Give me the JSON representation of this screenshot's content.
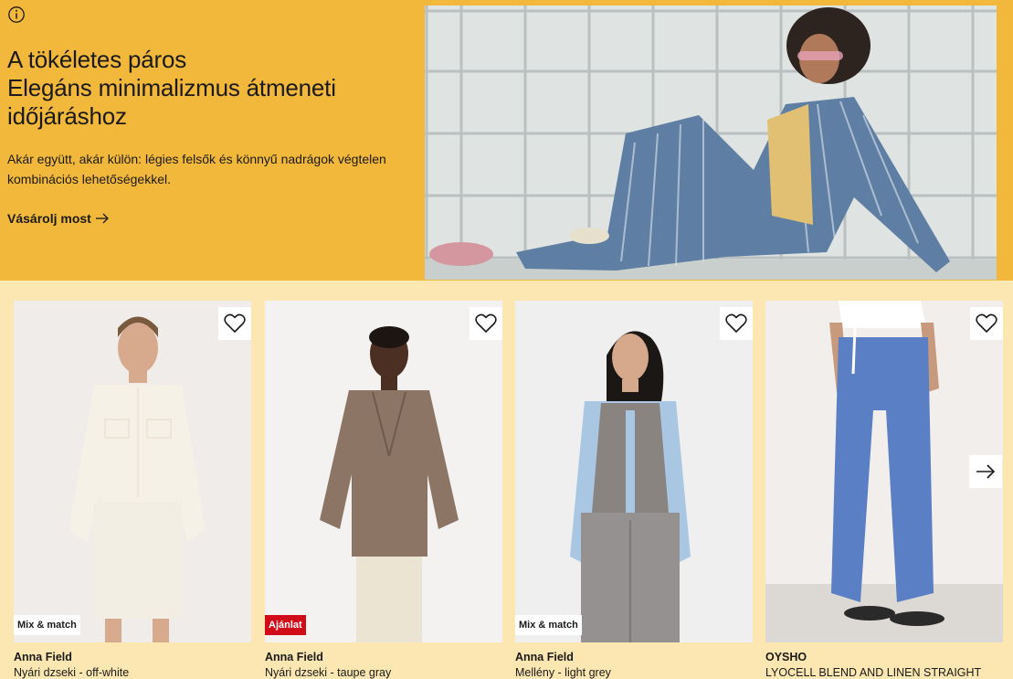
{
  "hero": {
    "title_lines": [
      "A tökéletes páros",
      "Elegáns minimalizmus átmeneti",
      "időjáráshoz"
    ],
    "description": "Akár együtt, akár külön: légies felsők és könnyű nadrágok végtelen kombinációs lehetőségekkel.",
    "cta_label": "Vásárolj most",
    "info_icon": "info-circle-icon",
    "cta_icon": "arrow-right-icon",
    "background_color": "#f1b83c"
  },
  "products": [
    {
      "brand": "Anna Field",
      "name": "Nyári dzseki - off-white",
      "badge": "Mix & match",
      "badge_type": "mix",
      "favorite_icon": "heart-outline-icon"
    },
    {
      "brand": "Anna Field",
      "name": "Nyári dzseki - taupe gray",
      "badge": "Ajánlat",
      "badge_type": "offer",
      "favorite_icon": "heart-outline-icon"
    },
    {
      "brand": "Anna Field",
      "name": "Mellény - light grey",
      "badge": "Mix & match",
      "badge_type": "mix",
      "favorite_icon": "heart-outline-icon"
    },
    {
      "brand": "OYSHO",
      "name": "LYOCELL BLEND AND LINEN STRAIGHT",
      "badge": "",
      "badge_type": "",
      "favorite_icon": "heart-outline-icon"
    }
  ],
  "carousel": {
    "next_icon": "arrow-right-icon"
  },
  "colors": {
    "page_background": "#fce7b2",
    "offer_badge": "#d10b17"
  }
}
